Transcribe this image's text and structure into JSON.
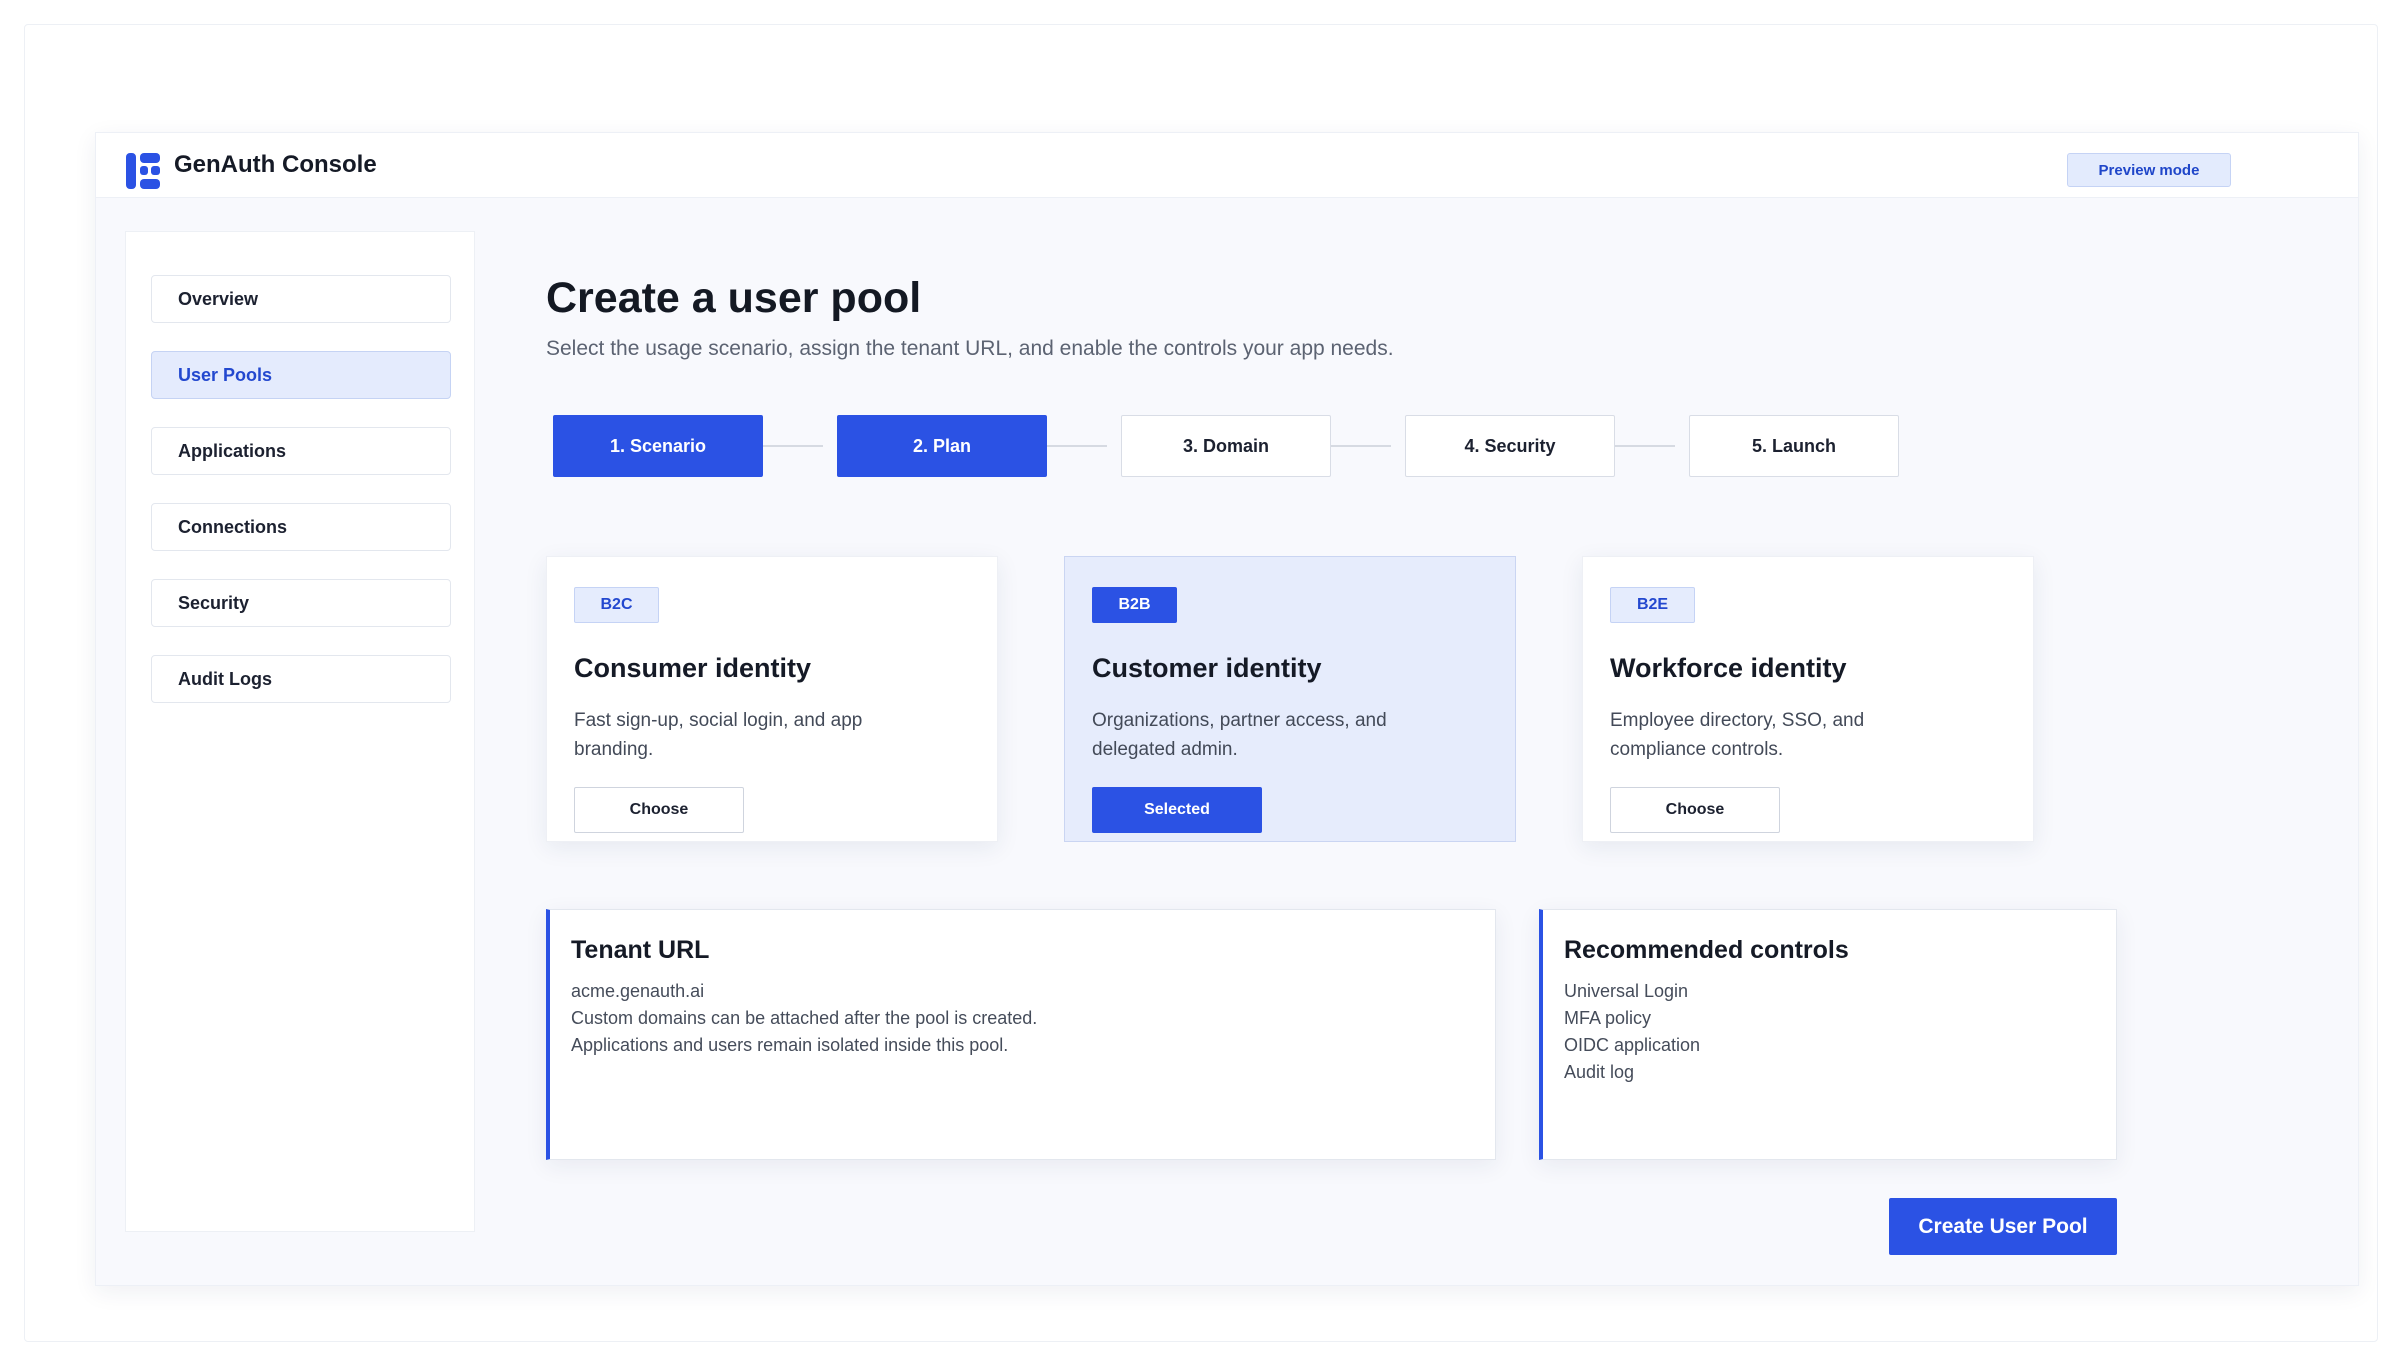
{
  "app": {
    "title": "GenAuth Console",
    "preview_label": "Preview mode",
    "accent_color": "#2b52e4"
  },
  "sidebar": {
    "items": [
      {
        "label": "Overview",
        "active": false
      },
      {
        "label": "User Pools",
        "active": true
      },
      {
        "label": "Applications",
        "active": false
      },
      {
        "label": "Connections",
        "active": false
      },
      {
        "label": "Security",
        "active": false
      },
      {
        "label": "Audit Logs",
        "active": false
      }
    ]
  },
  "page": {
    "title": "Create a user pool",
    "subtitle": "Select the usage scenario, assign the tenant URL, and enable the controls your app needs."
  },
  "steps": [
    {
      "label": "1. Scenario",
      "complete": true
    },
    {
      "label": "2. Plan",
      "complete": true
    },
    {
      "label": "3. Domain",
      "complete": false
    },
    {
      "label": "4. Security",
      "complete": false
    },
    {
      "label": "5. Launch",
      "complete": false
    }
  ],
  "scenarios": [
    {
      "badge": "B2C",
      "title": "Consumer identity",
      "desc": "Fast sign-up, social login, and app branding.",
      "button": "Choose",
      "selected": false
    },
    {
      "badge": "B2B",
      "title": "Customer identity",
      "desc": "Organizations, partner access, and delegated admin.",
      "button": "Selected",
      "selected": true
    },
    {
      "badge": "B2E",
      "title": "Workforce identity",
      "desc": "Employee directory, SSO, and compliance controls.",
      "button": "Choose",
      "selected": false
    }
  ],
  "tenant": {
    "title": "Tenant URL",
    "lines": [
      "acme.genauth.ai",
      "Custom domains can be attached after the pool is created.",
      "Applications and users remain isolated inside this pool."
    ]
  },
  "controls": {
    "title": "Recommended controls",
    "items": [
      "Universal Login",
      "MFA policy",
      "OIDC application",
      "Audit log"
    ]
  },
  "actions": {
    "create_label": "Create User Pool"
  }
}
